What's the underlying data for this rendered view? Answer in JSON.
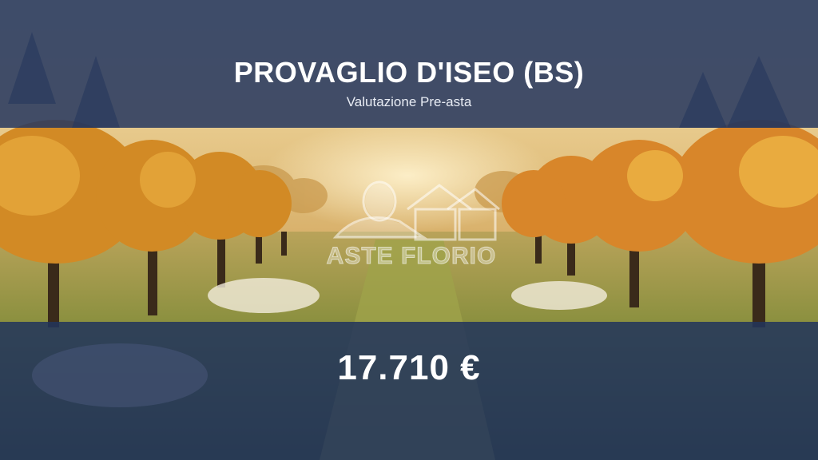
{
  "header": {
    "title": "PROVAGLIO D'ISEO (BS)",
    "subtitle": "Valutazione Pre-asta"
  },
  "price": {
    "value": "17.710 €"
  },
  "watermark": {
    "brand": "ASTE FLORIO"
  },
  "colors": {
    "band": "#263860",
    "foliage": "#d9952a",
    "grass": "#8a9a3c"
  }
}
